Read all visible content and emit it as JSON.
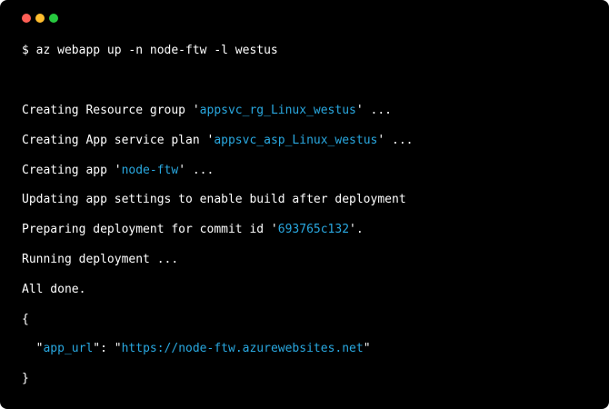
{
  "window": {
    "controls": [
      {
        "name": "close",
        "color": "#ff5f56"
      },
      {
        "name": "minimize",
        "color": "#ffbd2e"
      },
      {
        "name": "maximize",
        "color": "#27c93f"
      }
    ]
  },
  "terminal": {
    "command": "$ az webapp up -n node-ftw -l westus",
    "output": {
      "resource_group": {
        "prefix": "Creating Resource group '",
        "value": "appsvc_rg_Linux_westus",
        "suffix": "' ..."
      },
      "service_plan": {
        "prefix": "Creating App service plan '",
        "value": "appsvc_asp_Linux_westus",
        "suffix": "' ..."
      },
      "create_app": {
        "prefix": "Creating app '",
        "value": "node-ftw",
        "suffix": "' ..."
      },
      "app_settings": "Updating app settings to enable build after deployment",
      "preparing": {
        "prefix": "Preparing deployment for commit id '",
        "value": "693765c132",
        "suffix": "'."
      },
      "running": "Running deployment ...",
      "done": "All done.",
      "json_open": "{",
      "app_url": {
        "indent": "  ",
        "quote_open": "\"",
        "key": "app_url",
        "separator": "\": \"",
        "value": "https://node-ftw.azurewebsites.net",
        "quote_close": "\""
      },
      "json_close": "}"
    }
  }
}
